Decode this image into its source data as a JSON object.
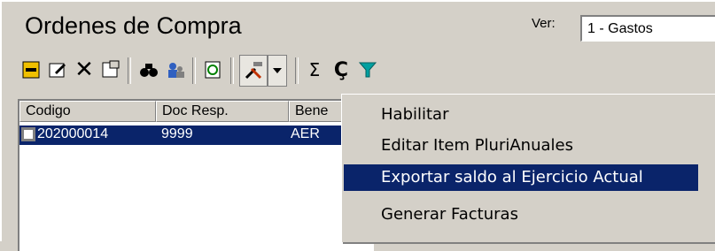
{
  "window": {
    "title": "Ordenes de Compra"
  },
  "view": {
    "label": "Ver:",
    "selected": "1 - Gastos"
  },
  "toolbar": {
    "icons": [
      "new-icon",
      "edit-icon",
      "delete-icon",
      "properties-icon",
      "find-icon",
      "users-icon",
      "refresh-icon",
      "tools-icon",
      "dropdown-icon",
      "sum-icon",
      "cedilla-icon",
      "filter-icon"
    ],
    "sum_glyph": "Σ",
    "cedilla_glyph": "Ç"
  },
  "list": {
    "columns": [
      "Codigo",
      "Doc Resp.",
      "Bene"
    ],
    "rows": [
      {
        "codigo": "202000014",
        "doc": "9999",
        "bene": "AER"
      }
    ]
  },
  "menu": {
    "items": [
      "Habilitar",
      "Editar Item PluriAnuales",
      "Exportar saldo al Ejercicio Actual",
      "Generar Facturas"
    ],
    "selected_index": 2
  }
}
